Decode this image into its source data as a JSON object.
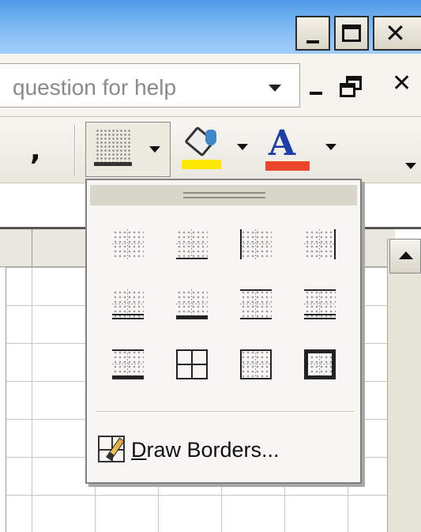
{
  "window": {
    "controls": [
      "minimize-icon",
      "maximize-icon",
      "close-icon"
    ]
  },
  "menu": {
    "ask_placeholder": "question for help",
    "doc_controls": [
      "minimize-icon",
      "restore-icon",
      "close-icon"
    ]
  },
  "toolbar": {
    "comma_style": ",",
    "more_buttons": "»",
    "fill_color": "#ffe800",
    "font_color": "#e8452a",
    "font_color_letter": "A",
    "buttons": [
      "comma-style-button",
      "borders-button",
      "fill-color-button",
      "font-color-button",
      "toolbar-options-button"
    ]
  },
  "borders_palette": {
    "options": [
      "No Border",
      "Bottom Border",
      "Left Border",
      "Right Border",
      "Bottom Double Border",
      "Thick Bottom Border",
      "Top and Bottom Border",
      "Top and Double Bottom Border",
      "Top and Thick Bottom Border",
      "All Borders",
      "Outside Borders",
      "Thick Box Border"
    ],
    "draw_borders_label_accel": "D",
    "draw_borders_label_rest": "raw Borders..."
  }
}
